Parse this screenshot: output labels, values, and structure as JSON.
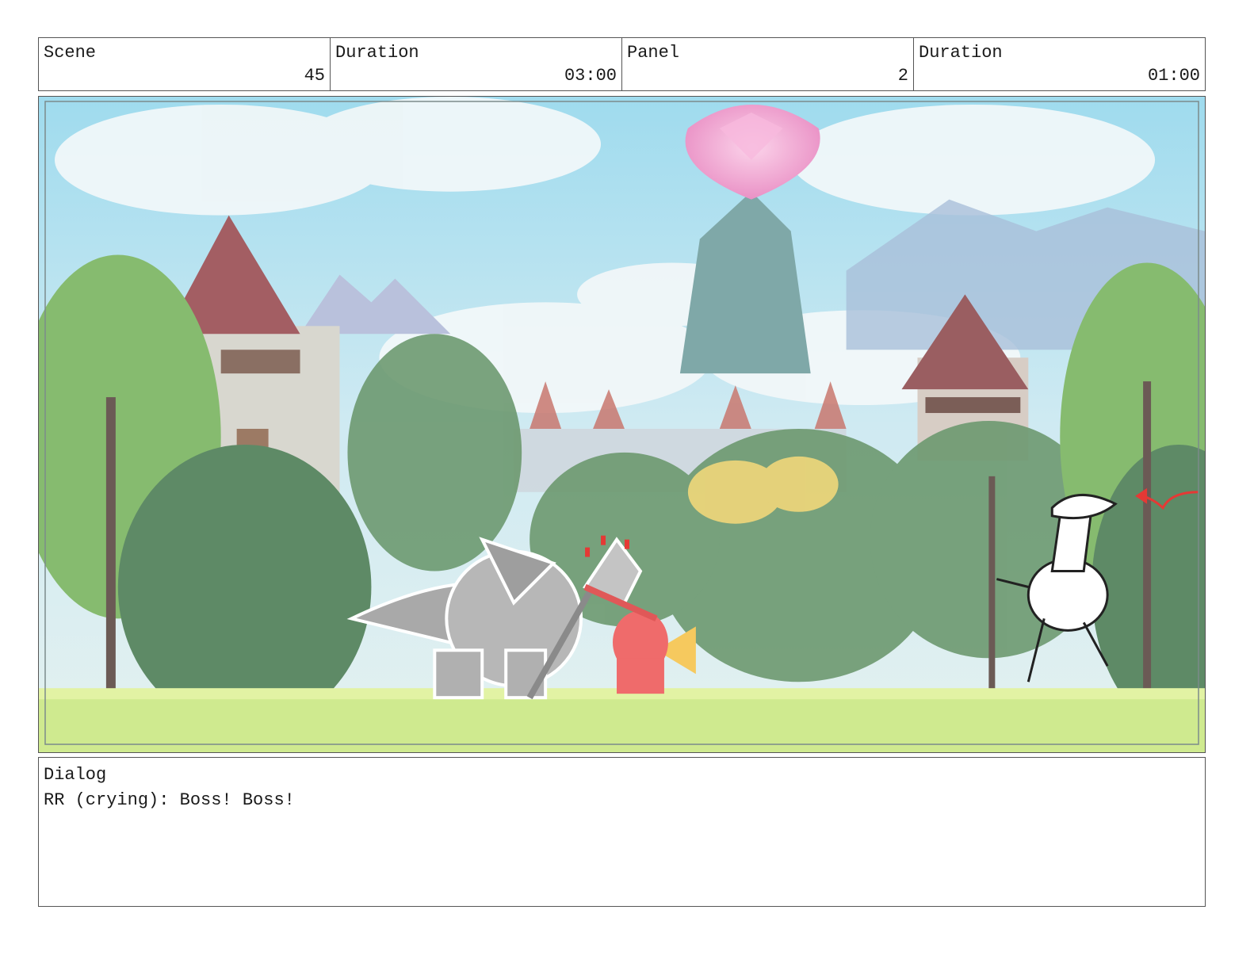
{
  "header": {
    "scene_label": "Scene",
    "scene_value": "45",
    "scene_duration_label": "Duration",
    "scene_duration_value": "03:00",
    "panel_label": "Panel",
    "panel_value": "2",
    "panel_duration_label": "Duration",
    "panel_duration_value": "01:00"
  },
  "dialog": {
    "label": "Dialog",
    "text": "RR (crying): Boss! Boss!"
  },
  "colors": {
    "sky": "#bfe6f0",
    "grass": "#cdea8a",
    "crystal": "#f2a3cf",
    "red_character": "#ef6b6b",
    "arrow": "#e53935"
  }
}
